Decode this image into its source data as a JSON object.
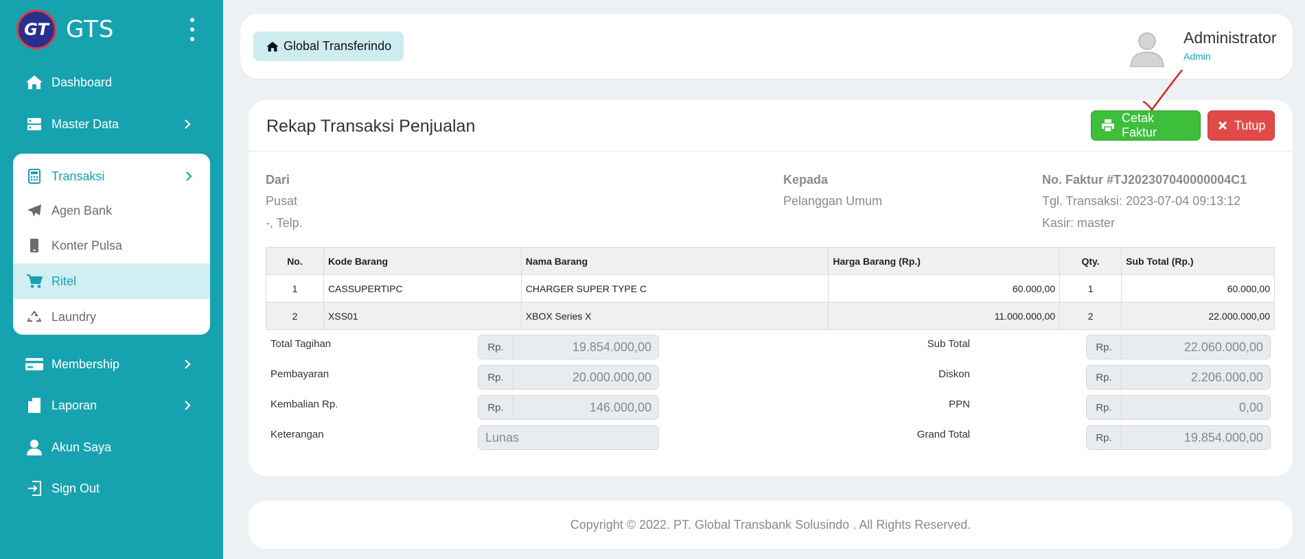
{
  "brand": {
    "title": "GTS",
    "logo_text": "GT"
  },
  "sidebar": {
    "items": [
      {
        "label": "Dashboard"
      },
      {
        "label": "Master Data"
      },
      {
        "label": "Transaksi"
      },
      {
        "label": "Agen Bank"
      },
      {
        "label": "Konter Pulsa"
      },
      {
        "label": "Ritel"
      },
      {
        "label": "Laundry"
      },
      {
        "label": "Membership"
      },
      {
        "label": "Laporan"
      },
      {
        "label": "Akun Saya"
      },
      {
        "label": "Sign Out"
      }
    ]
  },
  "header": {
    "breadcrumb": "Global Transferindo",
    "user_name": "Administrator",
    "user_role": "Admin"
  },
  "main": {
    "title": "Rekap Transaksi Penjualan",
    "print_label": "Cetak Faktur",
    "close_label": "Tutup",
    "from": {
      "heading": "Dari",
      "name": "Pusat",
      "contact": "-, Telp."
    },
    "to": {
      "heading": "Kepada",
      "name": "Pelanggan Umum"
    },
    "invoice": {
      "number": "No. Faktur #TJ202307040000004C1",
      "date": "Tgl. Transaksi: 2023-07-04 09:13:12",
      "cashier": "Kasir: master"
    },
    "table": {
      "headers": [
        "No.",
        "Kode Barang",
        "Nama Barang",
        "Harga Barang (Rp.)",
        "Qty.",
        "Sub Total (Rp.)"
      ],
      "rows": [
        [
          "1",
          "CASSUPERTIPC",
          "CHARGER SUPER TYPE C",
          "60.000,00",
          "1",
          "60.000,00"
        ],
        [
          "2",
          "XSS01",
          "XBOX Series X",
          "11.000.000,00",
          "2",
          "22.000.000,00"
        ]
      ]
    },
    "summary": {
      "prefix": "Rp.",
      "total_tagihan_label": "Total Tagihan",
      "total_tagihan": "19.854.000,00",
      "pembayaran_label": "Pembayaran",
      "pembayaran": "20.000.000,00",
      "kembalian_label": "Kembalian Rp.",
      "kembalian": "146.000,00",
      "keterangan_label": "Keterangan",
      "keterangan": "Lunas",
      "subtotal_label": "Sub Total",
      "subtotal": "22.060.000,00",
      "diskon_label": "Diskon",
      "diskon": "2.206.000,00",
      "ppn_label": "PPN",
      "ppn": "0,00",
      "grand_total_label": "Grand Total",
      "grand_total": "19.854.000,00"
    }
  },
  "footer": {
    "text": "Copyright © 2022. PT. Global Transbank Solusindo . All Rights Reserved."
  },
  "colors": {
    "accent": "#17a2b0",
    "success": "#3dbf3b",
    "danger": "#e24a4a"
  }
}
